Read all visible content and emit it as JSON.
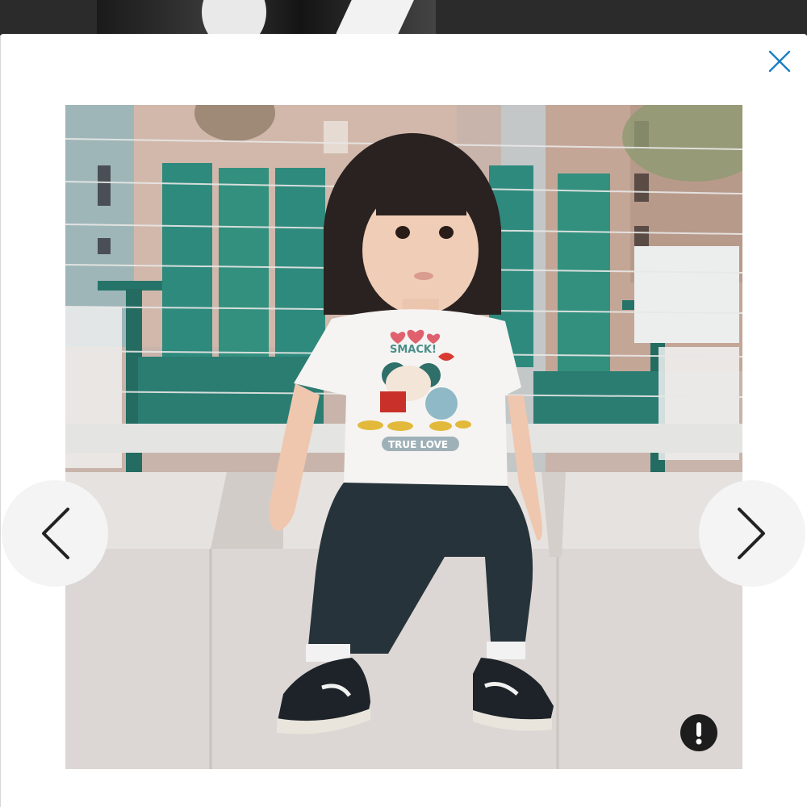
{
  "viewer": {
    "close_icon": "close-icon",
    "prev_icon": "chevron-left-icon",
    "next_icon": "chevron-right-icon",
    "report_icon": "exclamation-icon"
  },
  "photo": {
    "shirt_top_text": "SMACK!",
    "shirt_bottom_text": "TRUE LOVE",
    "colors": {
      "chair": "#2f8a7e",
      "building": "#c9a99a",
      "concrete": "#dcd7d4",
      "shirt": "#f5f4f2",
      "leggings": "#27333a"
    }
  }
}
